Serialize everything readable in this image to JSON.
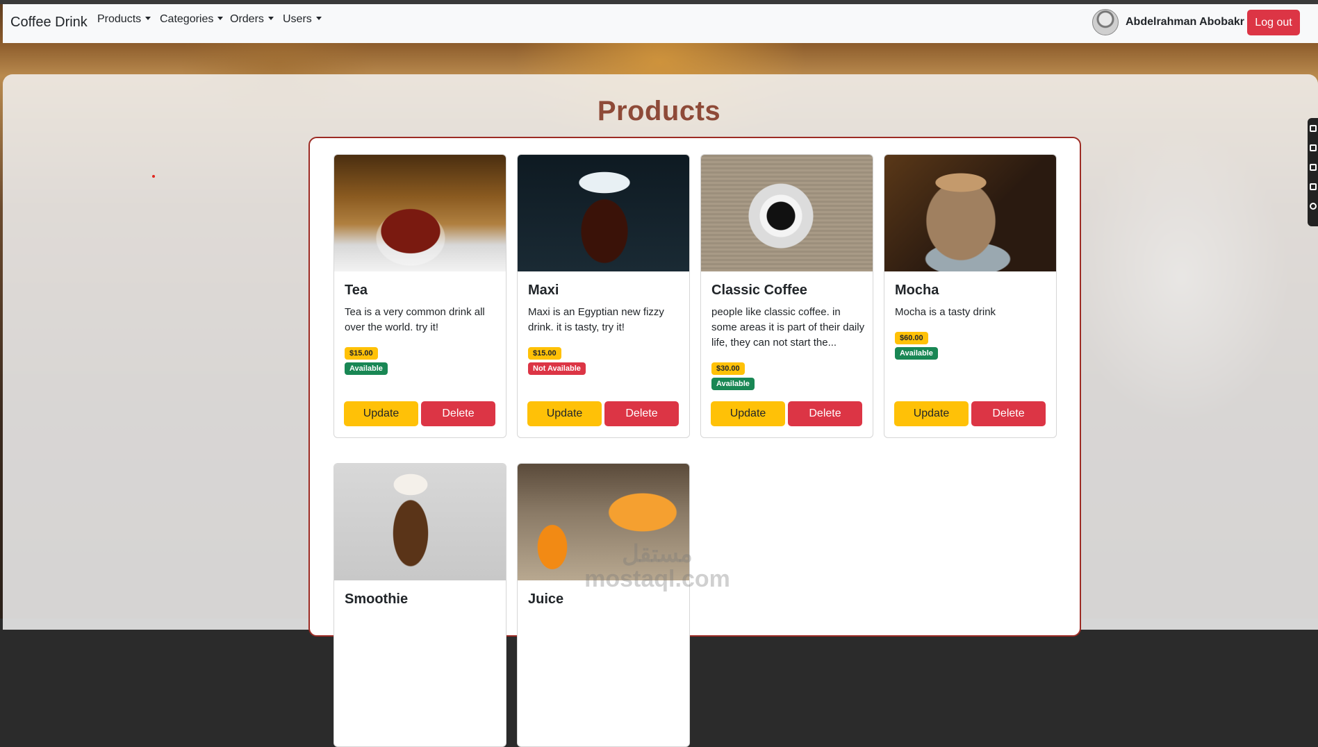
{
  "navbar": {
    "brand": "Coffee Drink",
    "menu": [
      {
        "label": "Products"
      },
      {
        "label": "Categories"
      },
      {
        "label": "Orders"
      },
      {
        "label": "Users"
      }
    ],
    "user_name": "Abdelrahman Abobakr",
    "logout_label": "Log out"
  },
  "page": {
    "title": "Products"
  },
  "buttons": {
    "update": "Update",
    "delete": "Delete"
  },
  "products": [
    {
      "name": "Tea",
      "description": "Tea is a very common drink all over the world. try it!",
      "price": "$15.00",
      "status": "Available"
    },
    {
      "name": "Maxi",
      "description": "Maxi is an Egyptian new fizzy drink. it is tasty, try it!",
      "price": "$15.00",
      "status": "Not Available"
    },
    {
      "name": "Classic Coffee",
      "description": "people like classic coffee. in some areas it is part of their daily life, they can not start the...",
      "price": "$30.00",
      "status": "Available"
    },
    {
      "name": "Mocha",
      "description": "Mocha is a tasty drink",
      "price": "$60.00",
      "status": "Available"
    },
    {
      "name": "Smoothie",
      "description": "",
      "price": "",
      "status": ""
    },
    {
      "name": "Juice",
      "description": "",
      "price": "",
      "status": ""
    }
  ],
  "watermark": {
    "arabic": "مستقل",
    "domain": "mostaql.com"
  },
  "colors": {
    "accent_title": "#8e4a38",
    "border": "#9c2b24",
    "warning": "#ffc107",
    "danger": "#dc3545",
    "success": "#198754"
  }
}
